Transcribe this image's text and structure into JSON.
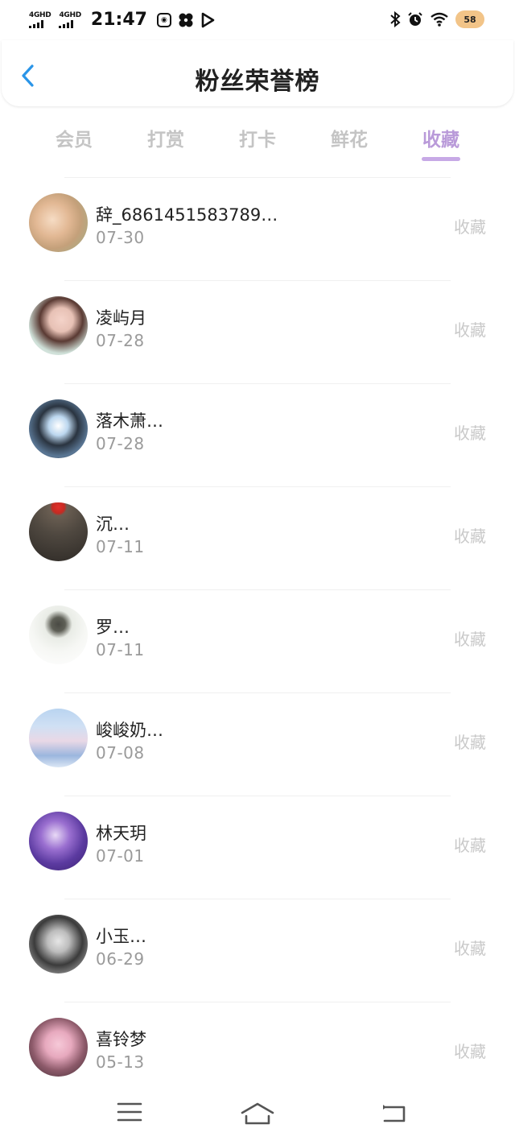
{
  "status_bar": {
    "network_1": "4GHD",
    "network_2": "4GHD",
    "time": "21:47",
    "battery": "58",
    "icons": [
      "hd-app-icon",
      "fan-app-icon",
      "play-app-icon",
      "bluetooth-icon",
      "alarm-icon",
      "wifi-icon",
      "battery-icon"
    ]
  },
  "header": {
    "title": "粉丝荣誉榜",
    "back_icon": "chevron-left-icon"
  },
  "tabs": [
    {
      "label": "会员",
      "active": false
    },
    {
      "label": "打赏",
      "active": false
    },
    {
      "label": "打卡",
      "active": false
    },
    {
      "label": "鲜花",
      "active": false
    },
    {
      "label": "收藏",
      "active": true
    }
  ],
  "colors": {
    "accent": "#b99ad9",
    "back_arrow": "#2a95e8",
    "muted_text": "#9a9a9a",
    "action_text": "#c9c9c9"
  },
  "fans": [
    {
      "name": "辞_6861451583789…",
      "date": "07-30",
      "action": "收藏"
    },
    {
      "name": "凌屿月",
      "date": "07-28",
      "action": "收藏"
    },
    {
      "name": "落木萧…",
      "date": "07-28",
      "action": "收藏"
    },
    {
      "name": "沉…",
      "date": "07-11",
      "action": "收藏"
    },
    {
      "name": "罗…",
      "date": "07-11",
      "action": "收藏"
    },
    {
      "name": "峻峻奶…",
      "date": "07-08",
      "action": "收藏"
    },
    {
      "name": "林天玥",
      "date": "07-01",
      "action": "收藏"
    },
    {
      "name": "小玉…",
      "date": "06-29",
      "action": "收藏"
    },
    {
      "name": "喜铃梦",
      "date": "05-13",
      "action": "收藏"
    }
  ],
  "nav_bar": {
    "icons": [
      "menu-icon",
      "home-icon",
      "back-icon"
    ]
  }
}
